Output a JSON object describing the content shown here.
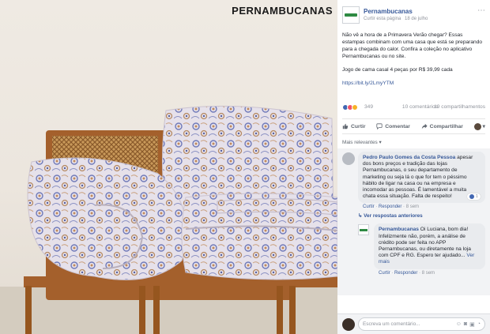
{
  "photo": {
    "brand_watermark": "PERNAMBUCANAS"
  },
  "post": {
    "page_name": "Pernambucanas",
    "subtitle_author": "Curtir esta página",
    "subtitle_date": "18 de julho",
    "more_icon": "ellipsis-icon",
    "paragraph_1": "Não vê a hora de a Primavera Verão chegar? Essas estampas combinam com uma casa que está se preparando para a chegada do calor. Confira a coleção no aplicativo Pernambucanas ou no site.",
    "paragraph_2": "Jogo de cama casal 4 peças por R$ 39,99 cada",
    "link": "https://bit.ly/2LmyYTM"
  },
  "reactions": {
    "count": "349",
    "comments": "10 comentários",
    "shares": "19 compartilhamentos"
  },
  "actions": {
    "like": "Curtir",
    "comment": "Comentar",
    "share": "Compartilhar"
  },
  "filter": {
    "label": "Mais relevantes"
  },
  "comments": [
    {
      "author": "Pedro Paulo Gomes da Costa Pessoa",
      "text": "apesar dos bons preços e tradição das lojas Pernambucanas, o seu departamento de marketing ou seja lá o que for tem o péssimo hábito de ligar na casa ou na empresa e incomodar as pessoas. É lamentável a muita chata essa situação. Falta de respeito!",
      "like": "Curtir",
      "reply": "Responder",
      "age": "8 sem",
      "likes": "1"
    }
  ],
  "replies_link": "Ver respostas anteriores",
  "reply": {
    "author": "Pernambucanas",
    "text": "Oi Luciana, bom dia! Infelizmente não, porém, a análise de crédito pode ser feita no APP Pernambucanas, ou diretamente na loja com CPF e RG. Espero ter ajudado...",
    "see_more": "Ver mais",
    "like": "Curtir",
    "reply": "Responder",
    "age": "8 sem"
  },
  "composer": {
    "placeholder": "Escreva um comentário..."
  },
  "colors": {
    "link_blue": "#365899",
    "brand_green": "#2e8a43",
    "meta_gray": "#90949c"
  }
}
